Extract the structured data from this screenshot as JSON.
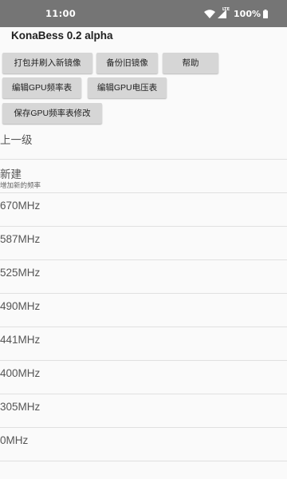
{
  "status_bar": {
    "time": "11:00",
    "battery": "100%",
    "network": "LTE",
    "icons": [
      "wifi-icon",
      "signal-icon",
      "battery-icon"
    ]
  },
  "app_bar": {
    "title": "KonaBess 0.2 alpha"
  },
  "buttons": {
    "pack_flash": "打包并刷入新镜像",
    "backup": "备份旧镜像",
    "help": "帮助",
    "edit_freq": "编辑GPU频率表",
    "edit_voltage": "编辑GPU电压表",
    "save_mod": "保存GPU频率表修改"
  },
  "list": {
    "back": "上一级",
    "new_title": "新建",
    "new_subtitle": "增加新的频率",
    "frequencies": [
      "670MHz",
      "587MHz",
      "525MHz",
      "490MHz",
      "441MHz",
      "400MHz",
      "305MHz",
      "0MHz"
    ]
  },
  "colors": {
    "status_bar_bg": "#757575",
    "background": "#fafafa",
    "button_bg": "#d6d6d6",
    "divider": "#e0e0e0"
  }
}
